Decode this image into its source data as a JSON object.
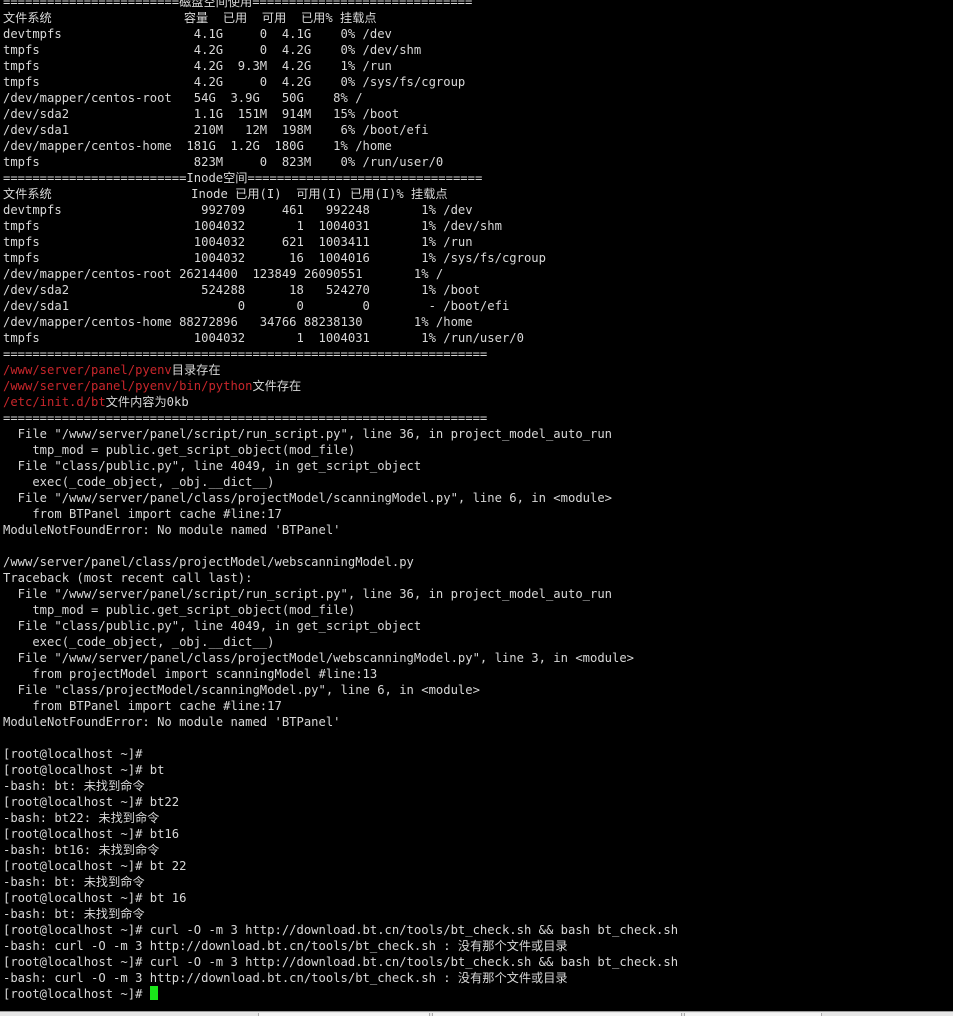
{
  "terminal": {
    "lines": [
      [
        {
          "t": "========================磁盘空间使用==============================",
          "c": "default"
        }
      ],
      [
        {
          "t": "文件系统                  容量  已用  可用  已用% 挂载点",
          "c": "default"
        }
      ],
      [
        {
          "t": "devtmpfs                  4.1G     0  4.1G    0% /dev",
          "c": "default"
        }
      ],
      [
        {
          "t": "tmpfs                     4.2G     0  4.2G    0% /dev/shm",
          "c": "default"
        }
      ],
      [
        {
          "t": "tmpfs                     4.2G  9.3M  4.2G    1% /run",
          "c": "default"
        }
      ],
      [
        {
          "t": "tmpfs                     4.2G     0  4.2G    0% /sys/fs/cgroup",
          "c": "default"
        }
      ],
      [
        {
          "t": "/dev/mapper/centos-root   54G  3.9G   50G    8% /",
          "c": "default"
        }
      ],
      [
        {
          "t": "/dev/sda2                 1.1G  151M  914M   15% /boot",
          "c": "default"
        }
      ],
      [
        {
          "t": "/dev/sda1                 210M   12M  198M    6% /boot/efi",
          "c": "default"
        }
      ],
      [
        {
          "t": "/dev/mapper/centos-home  181G  1.2G  180G    1% /home",
          "c": "default"
        }
      ],
      [
        {
          "t": "tmpfs                     823M     0  823M    0% /run/user/0",
          "c": "default"
        }
      ],
      [
        {
          "t": "=========================Inode空间================================",
          "c": "default"
        }
      ],
      [
        {
          "t": "文件系统                   Inode 已用(I)  可用(I) 已用(I)% 挂载点",
          "c": "default"
        }
      ],
      [
        {
          "t": "devtmpfs                   992709     461   992248       1% /dev",
          "c": "default"
        }
      ],
      [
        {
          "t": "tmpfs                     1004032       1  1004031       1% /dev/shm",
          "c": "default"
        }
      ],
      [
        {
          "t": "tmpfs                     1004032     621  1003411       1% /run",
          "c": "default"
        }
      ],
      [
        {
          "t": "tmpfs                     1004032      16  1004016       1% /sys/fs/cgroup",
          "c": "default"
        }
      ],
      [
        {
          "t": "/dev/mapper/centos-root 26214400  123849 26090551       1% /",
          "c": "default"
        }
      ],
      [
        {
          "t": "/dev/sda2                  524288      18   524270       1% /boot",
          "c": "default"
        }
      ],
      [
        {
          "t": "/dev/sda1                       0       0        0        - /boot/efi",
          "c": "default"
        }
      ],
      [
        {
          "t": "/dev/mapper/centos-home 88272896   34766 88238130       1% /home",
          "c": "default"
        }
      ],
      [
        {
          "t": "tmpfs                     1004032       1  1004031       1% /run/user/0",
          "c": "default"
        }
      ],
      [
        {
          "t": "==================================================================",
          "c": "default"
        }
      ],
      [
        {
          "t": "/www/server/panel/pyenv",
          "c": "red"
        },
        {
          "t": "目录存在",
          "c": "default"
        }
      ],
      [
        {
          "t": "/www/server/panel/pyenv/bin/python",
          "c": "red"
        },
        {
          "t": "文件存在",
          "c": "default"
        }
      ],
      [
        {
          "t": "/etc/init.d/bt",
          "c": "red"
        },
        {
          "t": "文件内容为0kb",
          "c": "default"
        }
      ],
      [
        {
          "t": "==================================================================",
          "c": "default"
        }
      ],
      [
        {
          "t": "  File \"/www/server/panel/script/run_script.py\", line 36, in project_model_auto_run",
          "c": "default"
        }
      ],
      [
        {
          "t": "    tmp_mod = public.get_script_object(mod_file)",
          "c": "default"
        }
      ],
      [
        {
          "t": "  File \"class/public.py\", line 4049, in get_script_object",
          "c": "default"
        }
      ],
      [
        {
          "t": "    exec(_code_object, _obj.__dict__)",
          "c": "default"
        }
      ],
      [
        {
          "t": "  File \"/www/server/panel/class/projectModel/scanningModel.py\", line 6, in <module>",
          "c": "default"
        }
      ],
      [
        {
          "t": "    from BTPanel import cache #line:17",
          "c": "default"
        }
      ],
      [
        {
          "t": "ModuleNotFoundError: No module named 'BTPanel'",
          "c": "default"
        }
      ],
      [
        {
          "t": "",
          "c": "default"
        }
      ],
      [
        {
          "t": "/www/server/panel/class/projectModel/webscanningModel.py",
          "c": "default"
        }
      ],
      [
        {
          "t": "Traceback (most recent call last):",
          "c": "default"
        }
      ],
      [
        {
          "t": "  File \"/www/server/panel/script/run_script.py\", line 36, in project_model_auto_run",
          "c": "default"
        }
      ],
      [
        {
          "t": "    tmp_mod = public.get_script_object(mod_file)",
          "c": "default"
        }
      ],
      [
        {
          "t": "  File \"class/public.py\", line 4049, in get_script_object",
          "c": "default"
        }
      ],
      [
        {
          "t": "    exec(_code_object, _obj.__dict__)",
          "c": "default"
        }
      ],
      [
        {
          "t": "  File \"/www/server/panel/class/projectModel/webscanningModel.py\", line 3, in <module>",
          "c": "default"
        }
      ],
      [
        {
          "t": "    from projectModel import scanningModel #line:13",
          "c": "default"
        }
      ],
      [
        {
          "t": "  File \"class/projectModel/scanningModel.py\", line 6, in <module>",
          "c": "default"
        }
      ],
      [
        {
          "t": "    from BTPanel import cache #line:17",
          "c": "default"
        }
      ],
      [
        {
          "t": "ModuleNotFoundError: No module named 'BTPanel'",
          "c": "default"
        }
      ],
      [
        {
          "t": "",
          "c": "default"
        }
      ],
      [
        {
          "t": "[root@localhost ~]#",
          "c": "default"
        }
      ],
      [
        {
          "t": "[root@localhost ~]# bt",
          "c": "default"
        }
      ],
      [
        {
          "t": "-bash: bt: 未找到命令",
          "c": "default"
        }
      ],
      [
        {
          "t": "[root@localhost ~]# bt22",
          "c": "default"
        }
      ],
      [
        {
          "t": "-bash: bt22: 未找到命令",
          "c": "default"
        }
      ],
      [
        {
          "t": "[root@localhost ~]# bt16",
          "c": "default"
        }
      ],
      [
        {
          "t": "-bash: bt16: 未找到命令",
          "c": "default"
        }
      ],
      [
        {
          "t": "[root@localhost ~]# bt 22",
          "c": "default"
        }
      ],
      [
        {
          "t": "-bash: bt: 未找到命令",
          "c": "default"
        }
      ],
      [
        {
          "t": "[root@localhost ~]# bt 16",
          "c": "default"
        }
      ],
      [
        {
          "t": "-bash: bt: 未找到命令",
          "c": "default"
        }
      ],
      [
        {
          "t": "[root@localhost ~]# curl -O -m 3 http://download.bt.cn/tools/bt_check.sh && bash bt_check.sh",
          "c": "default"
        }
      ],
      [
        {
          "t": "-bash: curl -O -m 3 http://download.bt.cn/tools/bt_check.sh : 没有那个文件或目录",
          "c": "default"
        }
      ],
      [
        {
          "t": "[root@localhost ~]# curl -O -m 3 http://download.bt.cn/tools/bt_check.sh && bash bt_check.sh",
          "c": "default"
        }
      ],
      [
        {
          "t": "-bash: curl -O -m 3 http://download.bt.cn/tools/bt_check.sh : 没有那个文件或目录",
          "c": "default"
        }
      ]
    ],
    "prompt": "[root@localhost ~]# ",
    "colors": {
      "red": "#c8262b",
      "default": "#d8d8d8",
      "cursor": "#19e619",
      "background": "#000000"
    }
  }
}
